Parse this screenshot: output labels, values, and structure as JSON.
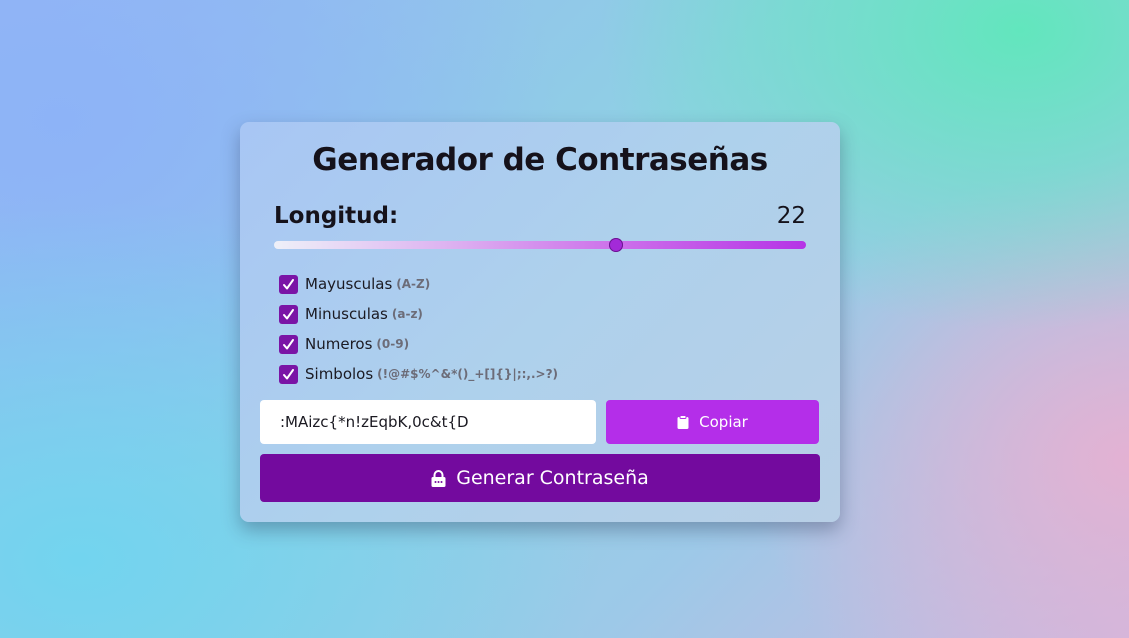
{
  "app": {
    "title": "Generador de Contraseñas"
  },
  "length": {
    "label": "Longitud:",
    "value": "22",
    "min": 4,
    "max": 32,
    "current": 22
  },
  "options": [
    {
      "label": "Mayusculas",
      "hint": "(A-Z)",
      "checked": true
    },
    {
      "label": "Minusculas",
      "hint": "(a-z)",
      "checked": true
    },
    {
      "label": "Numeros",
      "hint": "(0-9)",
      "checked": true
    },
    {
      "label": "Simbolos",
      "hint": "(!@#$%^&*()_+[]{}|;:,.>?)",
      "checked": true
    }
  ],
  "password": {
    "value": ":MAizc{*n!zEqbK,0c&t{D"
  },
  "buttons": {
    "copy_label": "Copiar",
    "copy_icon": "clipboard-icon",
    "generate_label": "Generar Contraseña",
    "generate_icon": "lock-icon"
  },
  "colors": {
    "accent": "#b42ee9",
    "primary": "#730a9e",
    "checkbox": "#7a14a6"
  }
}
